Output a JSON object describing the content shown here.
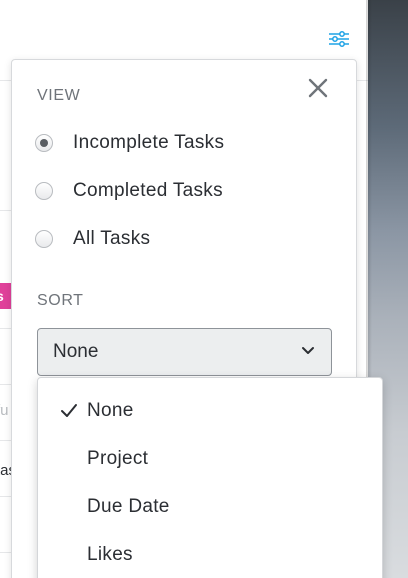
{
  "filter_popover": {
    "view_section_label": "VIEW",
    "view_options": [
      {
        "label": "Incomplete Tasks",
        "selected": true
      },
      {
        "label": "Completed Tasks",
        "selected": false
      },
      {
        "label": "All Tasks",
        "selected": false
      }
    ],
    "sort_section_label": "SORT",
    "sort_select": {
      "value": "None",
      "options": [
        {
          "label": "None",
          "checked": true
        },
        {
          "label": "Project",
          "checked": false
        },
        {
          "label": "Due Date",
          "checked": false
        },
        {
          "label": "Likes",
          "checked": false
        }
      ]
    },
    "close_icon": "close-icon",
    "filter_icon": "filter-sliders-icon"
  },
  "background": {
    "partial_texts": [
      "s",
      "I",
      "fu",
      "tas"
    ]
  },
  "colors": {
    "accent_blue": "#1fa3e6",
    "tag_pink": "#e0419a",
    "text_dark": "#2b2e33",
    "text_muted": "#6f747a"
  }
}
